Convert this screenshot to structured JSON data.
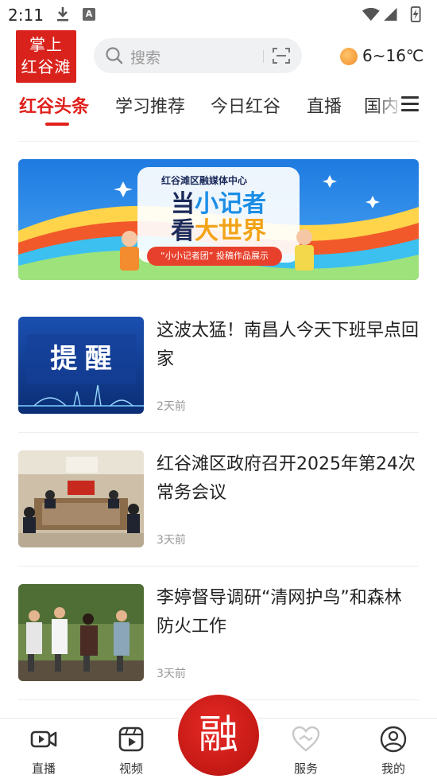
{
  "status_bar": {
    "time": "2:11",
    "notif_a": "A"
  },
  "header": {
    "logo_line1": "掌上",
    "logo_line2": "红谷滩",
    "search_placeholder": "搜索",
    "weather_temp": "6~16℃"
  },
  "tabs": [
    {
      "label": "红谷头条",
      "active": true
    },
    {
      "label": "学习推荐",
      "active": false
    },
    {
      "label": "今日红谷",
      "active": false
    },
    {
      "label": "直播",
      "active": false
    },
    {
      "label": "国内",
      "active": false
    }
  ],
  "banner": {
    "top_text": "红谷滩区融媒体中心",
    "line1_a": "当",
    "line1_b": "小记者",
    "line2_a": "看",
    "line2_b": "大世界",
    "ribbon": "“小小记者团” 投稿作品展示"
  },
  "news": [
    {
      "title": "这波太猛！南昌人今天下班早点回家",
      "time": "2天前",
      "thumb_text": "提 醒"
    },
    {
      "title": "红谷滩区政府召开2025年第24次常务会议",
      "time": "3天前"
    },
    {
      "title": "李婷督导调研“清网护鸟”和森林防火工作",
      "time": "3天前"
    }
  ],
  "bottom_nav": {
    "live": "直播",
    "video": "视频",
    "center": "融",
    "service": "服务",
    "mine": "我的"
  },
  "colors": {
    "accent": "#e0201b",
    "logo_bg": "#d9221c"
  }
}
